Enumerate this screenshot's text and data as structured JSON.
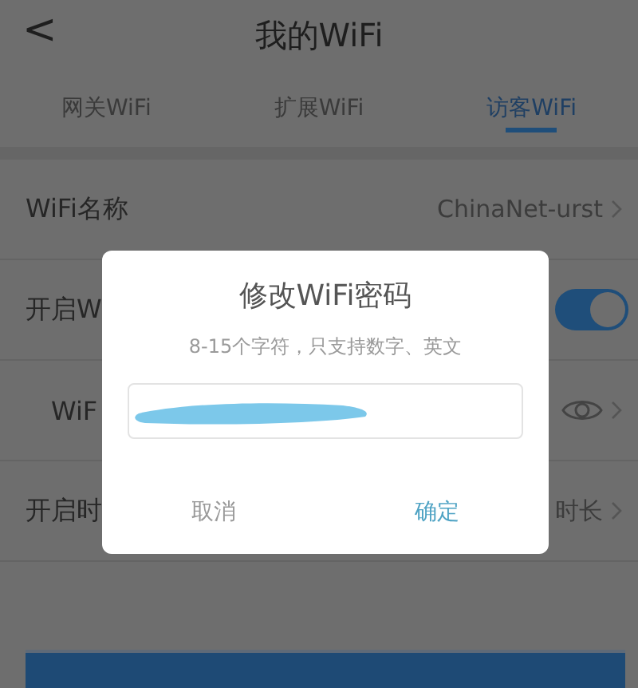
{
  "header": {
    "back": "<",
    "title": "我的WiFi"
  },
  "tabs": [
    {
      "label": "网关WiFi",
      "selected": false
    },
    {
      "label": "扩展WiFi",
      "selected": false
    },
    {
      "label": "访客WiFi",
      "selected": true
    }
  ],
  "rows": [
    {
      "kind": "value",
      "label": "WiFi名称",
      "value": "ChinaNet-urst"
    },
    {
      "kind": "toggle",
      "label": "开启W",
      "on": true
    },
    {
      "kind": "password",
      "label": "WiF"
    },
    {
      "kind": "value",
      "label": "开启时",
      "value": "时长"
    }
  ],
  "dialog": {
    "title": "修改WiFi密码",
    "hint": "8-15个字符，只支持数字、英文",
    "buttons": [
      {
        "label": "取消",
        "primary": false
      },
      {
        "label": "确定",
        "primary": true
      }
    ]
  }
}
